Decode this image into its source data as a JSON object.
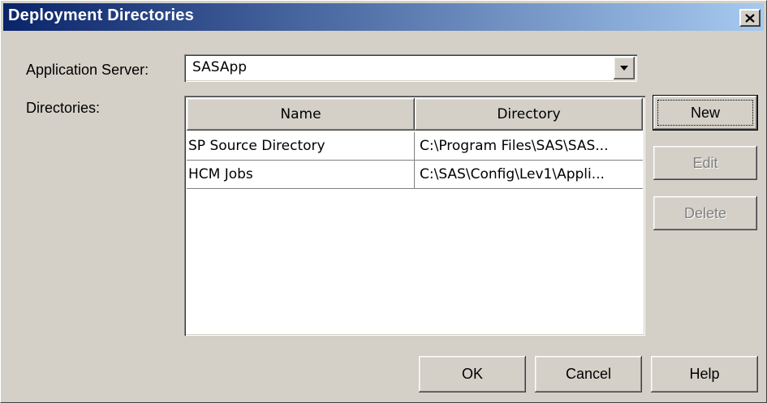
{
  "window": {
    "title": "Deployment Directories"
  },
  "form": {
    "app_server_label": "Application Server:",
    "app_server_value": "SASApp",
    "directories_label": "Directories:"
  },
  "table": {
    "columns": [
      "Name",
      "Directory"
    ],
    "rows": [
      {
        "name": "SP Source Directory",
        "directory": "C:\\Program Files\\SAS\\SAS..."
      },
      {
        "name": "HCM Jobs",
        "directory": "C:\\SAS\\Config\\Lev1\\Appli..."
      }
    ]
  },
  "side_buttons": {
    "new": "New",
    "edit": "Edit",
    "delete": "Delete"
  },
  "footer_buttons": {
    "ok": "OK",
    "cancel": "Cancel",
    "help": "Help"
  },
  "icons": {
    "close": "close-icon",
    "dropdown": "chevron-down-icon"
  }
}
